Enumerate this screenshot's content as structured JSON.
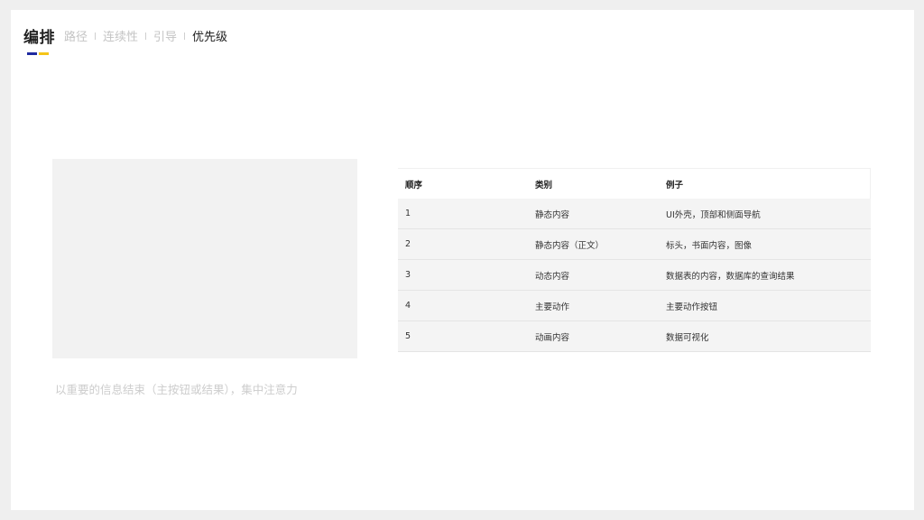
{
  "header": {
    "title": "编排",
    "nav": [
      {
        "label": "路径",
        "active": false
      },
      {
        "label": "连续性",
        "active": false
      },
      {
        "label": "引导",
        "active": false
      },
      {
        "label": "优先级",
        "active": true
      }
    ],
    "accent_colors": [
      "#1f2aa0",
      "#f5c518"
    ]
  },
  "main": {
    "caption": "以重要的信息结束（主按钮或结果），集中注意力"
  },
  "table": {
    "columns": [
      "顺序",
      "类别",
      "例子"
    ],
    "rows": [
      [
        "1",
        "静态内容",
        "UI外壳，顶部和侧面导航"
      ],
      [
        "2",
        "静态内容（正文）",
        "标头，书面内容，图像"
      ],
      [
        "3",
        "动态内容",
        "数据表的内容，数据库的查询结果"
      ],
      [
        "4",
        "主要动作",
        "主要动作按钮"
      ],
      [
        "5",
        "动画内容",
        "数据可视化"
      ]
    ]
  }
}
